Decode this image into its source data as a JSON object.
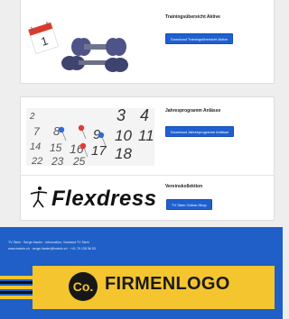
{
  "sections": [
    {
      "title": "Trainingsübersicht Aktive",
      "button": "Download Trainingsübersicht Aktive"
    },
    {
      "title": "Jahresprogramm Anlässe",
      "button": "Download Jahresprogramm Anlässe",
      "calendar_numbers": [
        "2",
        "3",
        "4",
        "7",
        "8",
        "9",
        "10",
        "11",
        "14",
        "15",
        "16",
        "17",
        "18",
        "22",
        "23",
        "25"
      ]
    },
    {
      "title": "Vereinskollektion",
      "brand": "Flexdress",
      "button": "TV Stein Online-Shop"
    }
  ],
  "footer": {
    "line1": "TV Stein · Serge Hasler · information, Vorstand TV Stein",
    "line2": "www.tvstein.ch · serge.hasler@tvstein.ch · +41 79 138 56 53"
  },
  "logo": {
    "badge": "Co.",
    "text": "FIRMENLOGO"
  },
  "colors": {
    "button": "#1f60d0",
    "footer": "#1f5fc7",
    "logo_yellow": "#f4c52e",
    "dumbbell": "#4e5487",
    "pin_red": "#e33b2e",
    "pin_blue": "#2f6ad8"
  }
}
